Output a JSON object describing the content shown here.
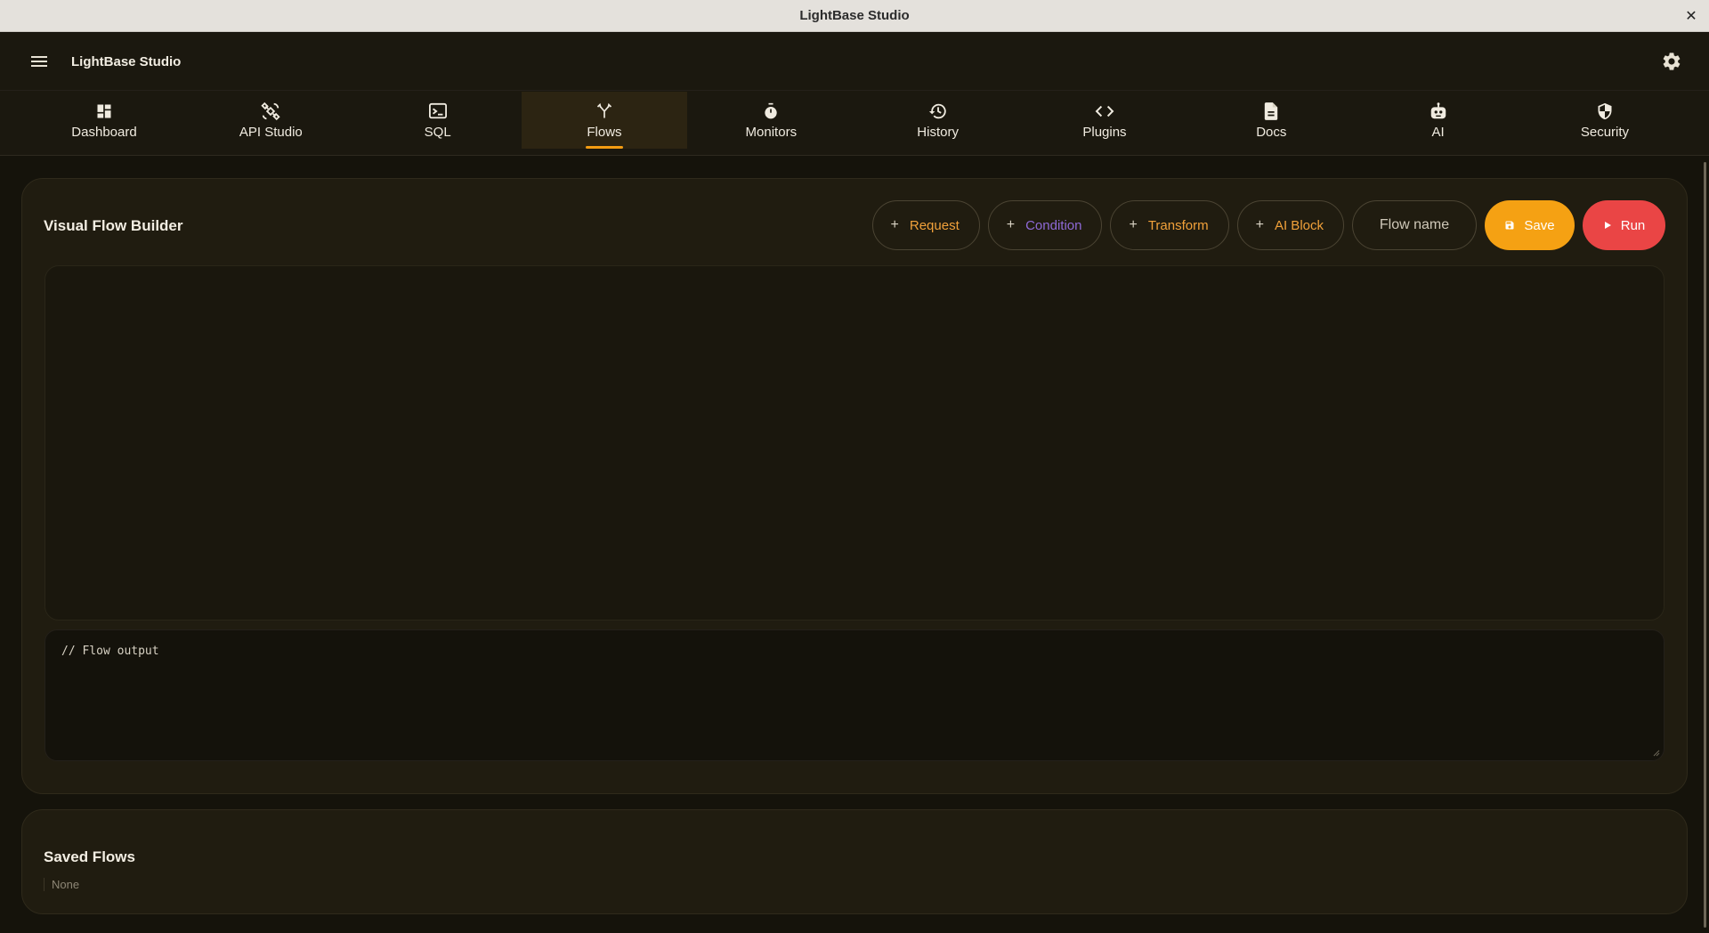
{
  "window": {
    "title": "LightBase Studio",
    "close_glyph": "✕"
  },
  "appbar": {
    "title": "LightBase Studio",
    "menu_icon": "hamburger-menu-icon",
    "settings_icon": "gear-icon"
  },
  "tabs": [
    {
      "label": "Dashboard",
      "icon": "dashboard-icon",
      "active": false
    },
    {
      "label": "API Studio",
      "icon": "satellite-icon",
      "active": false
    },
    {
      "label": "SQL",
      "icon": "terminal-icon",
      "active": false
    },
    {
      "label": "Flows",
      "icon": "merge-icon",
      "active": true
    },
    {
      "label": "Monitors",
      "icon": "timer-icon",
      "active": false
    },
    {
      "label": "History",
      "icon": "history-icon",
      "active": false
    },
    {
      "label": "Plugins",
      "icon": "code-icon",
      "active": false
    },
    {
      "label": "Docs",
      "icon": "document-icon",
      "active": false
    },
    {
      "label": "AI",
      "icon": "robot-icon",
      "active": false
    },
    {
      "label": "Security",
      "icon": "shield-icon",
      "active": false
    }
  ],
  "builder": {
    "title": "Visual Flow Builder",
    "add_buttons": {
      "plus": "+",
      "request": "Request",
      "condition": "Condition",
      "transform": "Transform",
      "ai_block": "AI Block"
    },
    "flow_name_placeholder": "Flow name",
    "save_label": "Save",
    "run_label": "Run",
    "output_text": "// Flow output"
  },
  "saved": {
    "title": "Saved Flows",
    "empty_text": "None"
  },
  "colors": {
    "accent": "#f39c12",
    "save": "#f5a113",
    "run": "#ea4545",
    "condition": "#8f6ad8",
    "background": "#15130b",
    "card": "#201c10"
  }
}
